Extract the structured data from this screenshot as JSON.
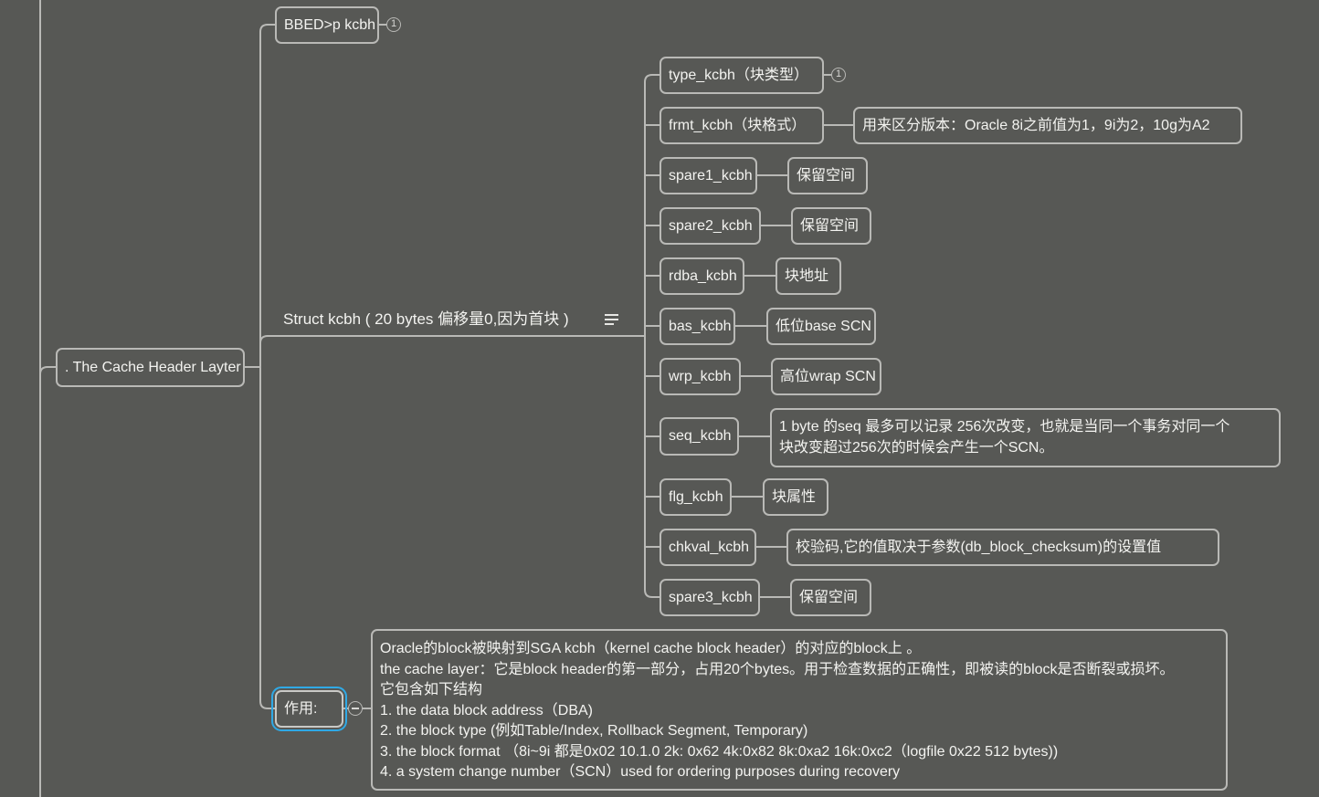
{
  "root": {
    "label": ".   The Cache Header Layter"
  },
  "branches": {
    "bbed": {
      "label": "BBED>p kcbh",
      "badge": "1"
    },
    "struct": {
      "label": "Struct  kcbh ( 20 bytes 偏移量0,因为首块 )",
      "icon": "notes-icon"
    },
    "zuoyong": {
      "label": "作用:",
      "toggle_icon": "collapse-icon"
    }
  },
  "fields": [
    {
      "label": "type_kcbh（块类型）",
      "badge": "1"
    },
    {
      "label": "frmt_kcbh（块格式）",
      "desc": "用来区分版本：Oracle 8i之前值为1，9i为2，10g为A2"
    },
    {
      "label": "spare1_kcbh",
      "desc": "保留空间"
    },
    {
      "label": "spare2_kcbh",
      "desc": "保留空间"
    },
    {
      "label": "rdba_kcbh",
      "desc": "块地址"
    },
    {
      "label": "bas_kcbh",
      "desc": "低位base SCN"
    },
    {
      "label": "wrp_kcbh",
      "desc": "高位wrap SCN"
    },
    {
      "label": "seq_kcbh",
      "desc_lines": [
        "1 byte 的seq 最多可以记录 256次改变，也就是当同一个事务对同一个",
        "块改变超过256次的时候会产生一个SCN。"
      ]
    },
    {
      "label": "flg_kcbh",
      "desc": "块属性"
    },
    {
      "label": "chkval_kcbh",
      "desc": "校验码,它的值取决于参数(db_block_checksum)的设置值"
    },
    {
      "label": "spare3_kcbh",
      "desc": "保留空间"
    }
  ],
  "note_lines": [
    "Oracle的block被映射到SGA kcbh（kernel cache block header）的对应的block上 。",
    "the cache layer：它是block header的第一部分，占用20个bytes。用于检查数据的正确性，即被读的block是否断裂或损坏。",
    "它包含如下结构",
    "1. the data block address（DBA)",
    "2. the block type (例如Table/Index, Rollback Segment, Temporary)",
    "3. the block format （8i~9i 都是0x02 10.1.0 2k: 0x62 4k:0x82 8k:0xa2 16k:0xc2（logfile 0x22 512  bytes))",
    "4. a system change number（SCN）used for ordering purposes during recovery"
  ]
}
